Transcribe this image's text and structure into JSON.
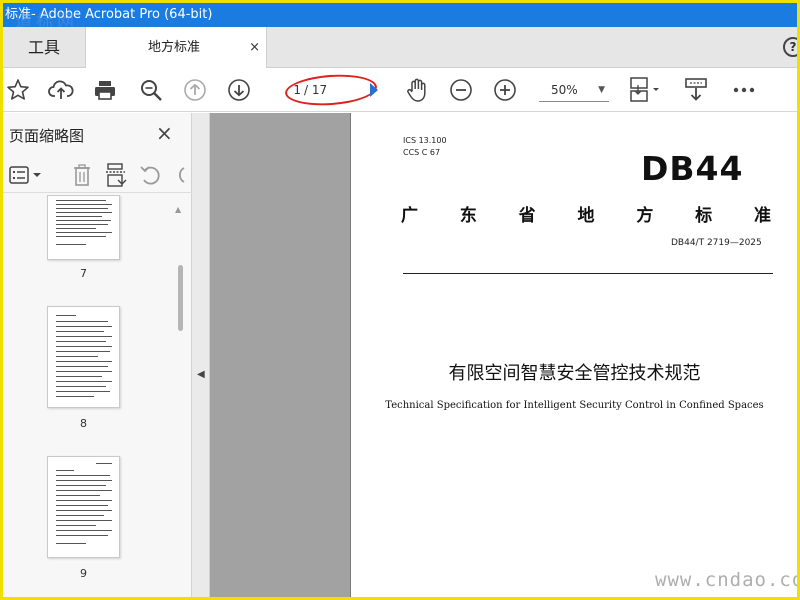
{
  "window": {
    "title": "标准- Adobe Acrobat Pro (64-bit)"
  },
  "watermark_top": "道标网",
  "watermark_bottom": "www.cndao.com",
  "tabs": {
    "tools": "工具",
    "document": "地方标准",
    "close": "×"
  },
  "help": "?",
  "toolbar": {
    "page_current": "1",
    "page_total": "/ 17",
    "zoom": "50%",
    "icons": [
      "star-icon",
      "cloud-upload-icon",
      "print-icon",
      "zoom-search-icon",
      "page-up-icon",
      "page-down-icon",
      "hand-icon",
      "zoom-out-icon",
      "zoom-in-icon",
      "scroll-mode-icon",
      "stamp-icon",
      "more-icon"
    ]
  },
  "left_panel": {
    "title": "页面缩略图",
    "close": "×",
    "thumbnails": [
      {
        "page": "7"
      },
      {
        "page": "8"
      },
      {
        "page": "9"
      }
    ]
  },
  "document": {
    "ics": "ICS  13.100",
    "ccs": "CCS  C 67",
    "db_code": "DB44",
    "province_chars": [
      "广",
      "东",
      "省",
      "地",
      "方",
      "标",
      "准"
    ],
    "standard_number": "DB44/T 2719—2025",
    "title_cn": "有限空间智慧安全管控技术规范",
    "title_en": "Technical Specification for Intelligent Security Control in Confined Spaces"
  }
}
